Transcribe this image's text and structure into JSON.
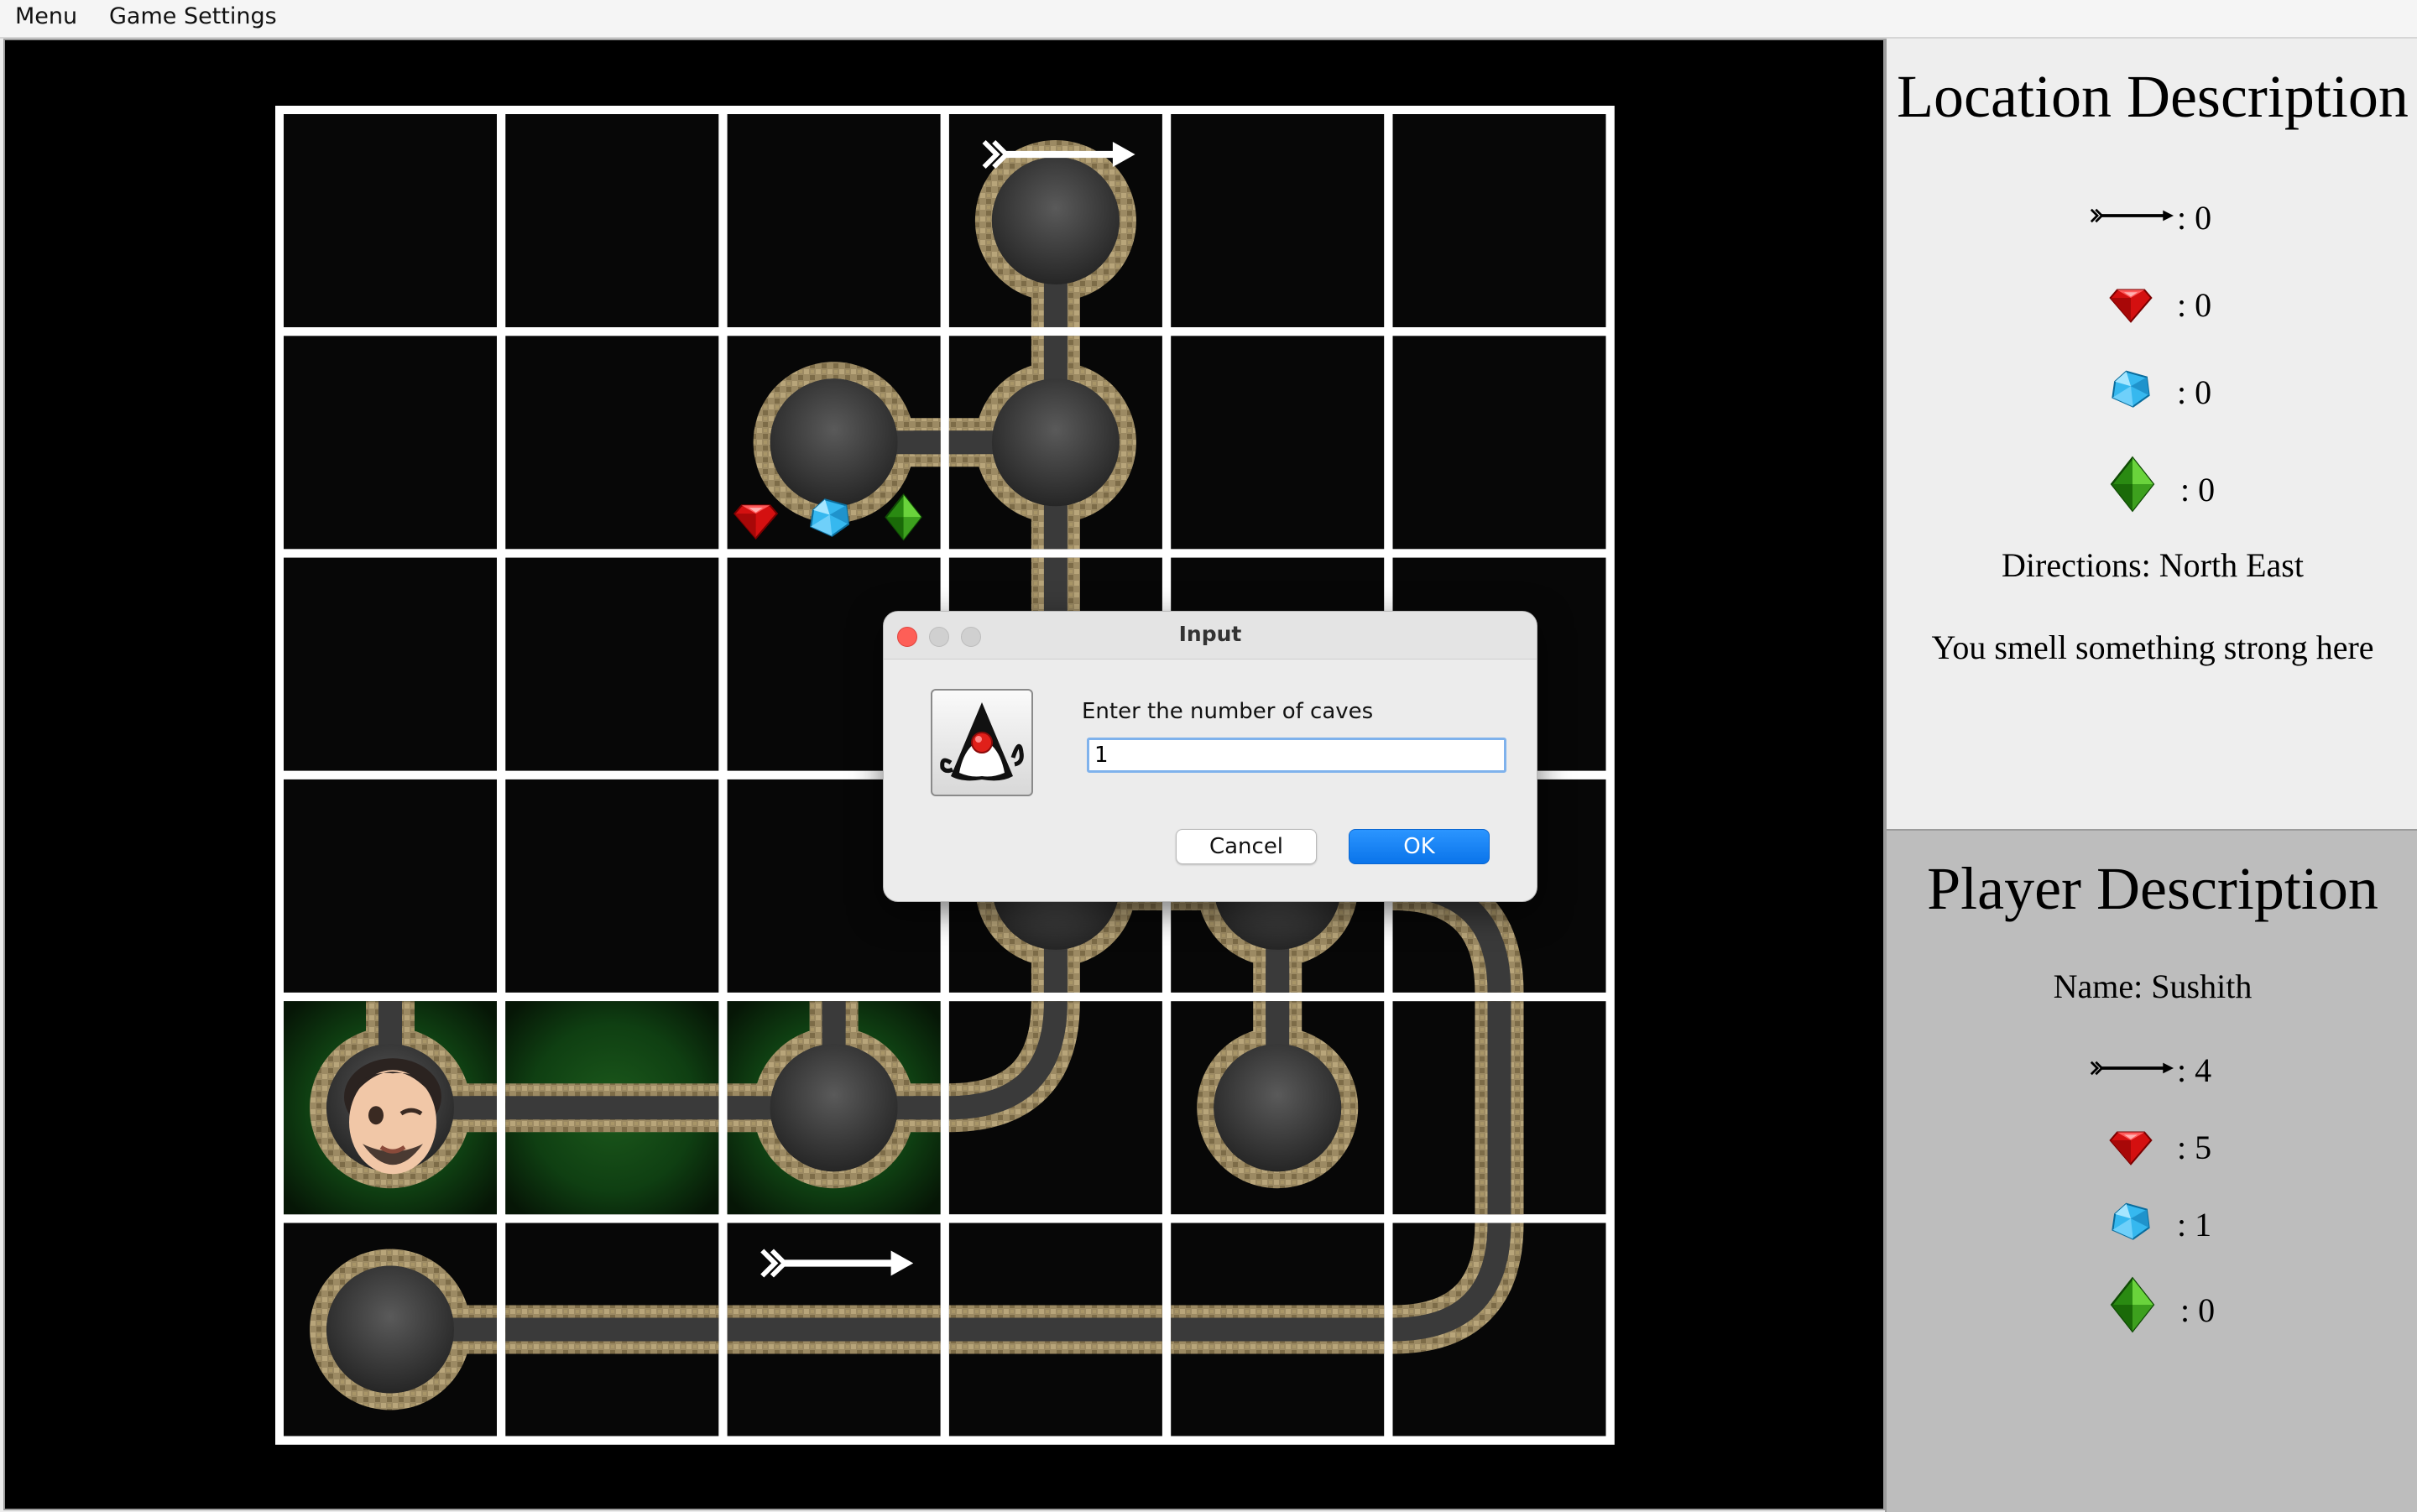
{
  "menu": {
    "items": [
      "Menu",
      "Game Settings"
    ]
  },
  "board": {
    "rows": 6,
    "cols": 6,
    "cells": [
      [
        null,
        null,
        null,
        {
          "type": "cave",
          "exits": [
            "S"
          ],
          "arrow": true
        },
        null,
        null
      ],
      [
        null,
        null,
        {
          "type": "cave",
          "exits": [
            "E"
          ],
          "treasure": [
            "ruby",
            "diamond",
            "emerald"
          ]
        },
        {
          "type": "cave",
          "exits": [
            "N",
            "S",
            "W"
          ]
        },
        null,
        null
      ],
      [
        null,
        null,
        null,
        {
          "type": "tunnel",
          "exits": [
            "N",
            "S"
          ]
        },
        null,
        null
      ],
      [
        null,
        null,
        null,
        {
          "type": "cave",
          "exits": [
            "N",
            "S",
            "E"
          ]
        },
        {
          "type": "cave",
          "exits": [
            "W",
            "S"
          ]
        },
        {
          "type": "tunnel",
          "exits": [
            "W",
            "S"
          ]
        }
      ],
      [
        {
          "type": "cave",
          "exits": [
            "N",
            "E"
          ],
          "player": true,
          "smell": true
        },
        {
          "type": "tunnel",
          "exits": [
            "W",
            "E"
          ],
          "smell": true
        },
        {
          "type": "cave",
          "exits": [
            "W",
            "N",
            "E"
          ],
          "smell": true
        },
        {
          "type": "tunnel",
          "exits": [
            "W",
            "N"
          ]
        },
        {
          "type": "cave",
          "exits": [
            "N"
          ]
        },
        {
          "type": "tunnel",
          "exits": [
            "N",
            "S"
          ]
        }
      ],
      [
        {
          "type": "cave",
          "exits": [
            "E"
          ]
        },
        {
          "type": "tunnel",
          "exits": [
            "W",
            "E"
          ]
        },
        {
          "type": "tunnel",
          "exits": [
            "W",
            "E"
          ],
          "arrow": true
        },
        {
          "type": "tunnel",
          "exits": [
            "W",
            "E"
          ]
        },
        {
          "type": "tunnel",
          "exits": [
            "W",
            "E"
          ]
        },
        {
          "type": "tunnel",
          "exits": [
            "W",
            "N"
          ]
        }
      ]
    ]
  },
  "location": {
    "title": "Location Description",
    "arrows": ": 0",
    "rubies": ": 0",
    "diamonds": ": 0",
    "emeralds": ": 0",
    "directions": "Directions: North East",
    "smell": "You smell something strong here"
  },
  "player": {
    "title": "Player Description",
    "name": "Name: Sushith",
    "arrows": ": 4",
    "rubies": ": 5",
    "diamonds": ": 1",
    "emeralds": ": 0"
  },
  "dialog": {
    "title": "Input",
    "prompt": "Enter the number of caves",
    "input_value": "1",
    "cancel_label": "Cancel",
    "ok_label": "OK"
  },
  "colors": {
    "ok_button": "#0a74ea",
    "input_border": "#7fb2ec",
    "close_light": "#fe5f57",
    "player_panel_bg": "#bdbdbd",
    "location_panel_bg": "#eeeeee"
  }
}
